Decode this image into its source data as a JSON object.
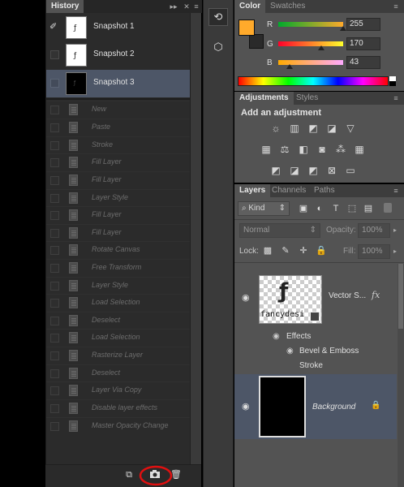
{
  "history": {
    "tab_label": "History",
    "menu_icon": "panel-menu-icon",
    "snapshots": [
      {
        "label": "Snapshot 1"
      },
      {
        "label": "Snapshot 2"
      },
      {
        "label": "Snapshot 3"
      }
    ],
    "states": [
      "New",
      "Paste",
      "Stroke",
      "Fill Layer",
      "Fill Layer",
      "Layer Style",
      "Fill Layer",
      "Fill Layer",
      "Rotate Canvas",
      "Free Transform",
      "Layer Style",
      "Load Selection",
      "Deselect",
      "Load Selection",
      "Rasterize Layer",
      "Deselect",
      "Layer Via Copy",
      "Disable layer effects",
      "Master Opacity Change"
    ],
    "bottom_icons": [
      "new-document-from-state-icon",
      "create-snapshot-icon",
      "trash-icon"
    ]
  },
  "color": {
    "tabs": [
      "Color",
      "Swatches"
    ],
    "swatch_hex": "#FFAA2B",
    "channels": [
      {
        "label": "R",
        "value": "255"
      },
      {
        "label": "G",
        "value": "170"
      },
      {
        "label": "B",
        "value": "43"
      }
    ]
  },
  "adjustments": {
    "tabs": [
      "Adjustments",
      "Styles"
    ],
    "heading": "Add an adjustment"
  },
  "layers": {
    "tabs": [
      "Layers",
      "Channels",
      "Paths"
    ],
    "filter_label": "Kind",
    "blend_mode": "Normal",
    "opacity_label": "Opacity:",
    "opacity_value": "100%",
    "lock_label": "Lock:",
    "fill_label": "Fill:",
    "fill_value": "100%",
    "items": [
      {
        "name": "Vector S...",
        "fx": "fx",
        "effects_label": "Effects",
        "effects": [
          "Bevel & Emboss",
          "Stroke"
        ]
      },
      {
        "name": "Background"
      }
    ],
    "thumb_text": "fancydesi"
  },
  "colors": {
    "accent_swatch": "#FFAA2B",
    "selection": "#4D5667",
    "highlight_ring": "#E01010"
  }
}
